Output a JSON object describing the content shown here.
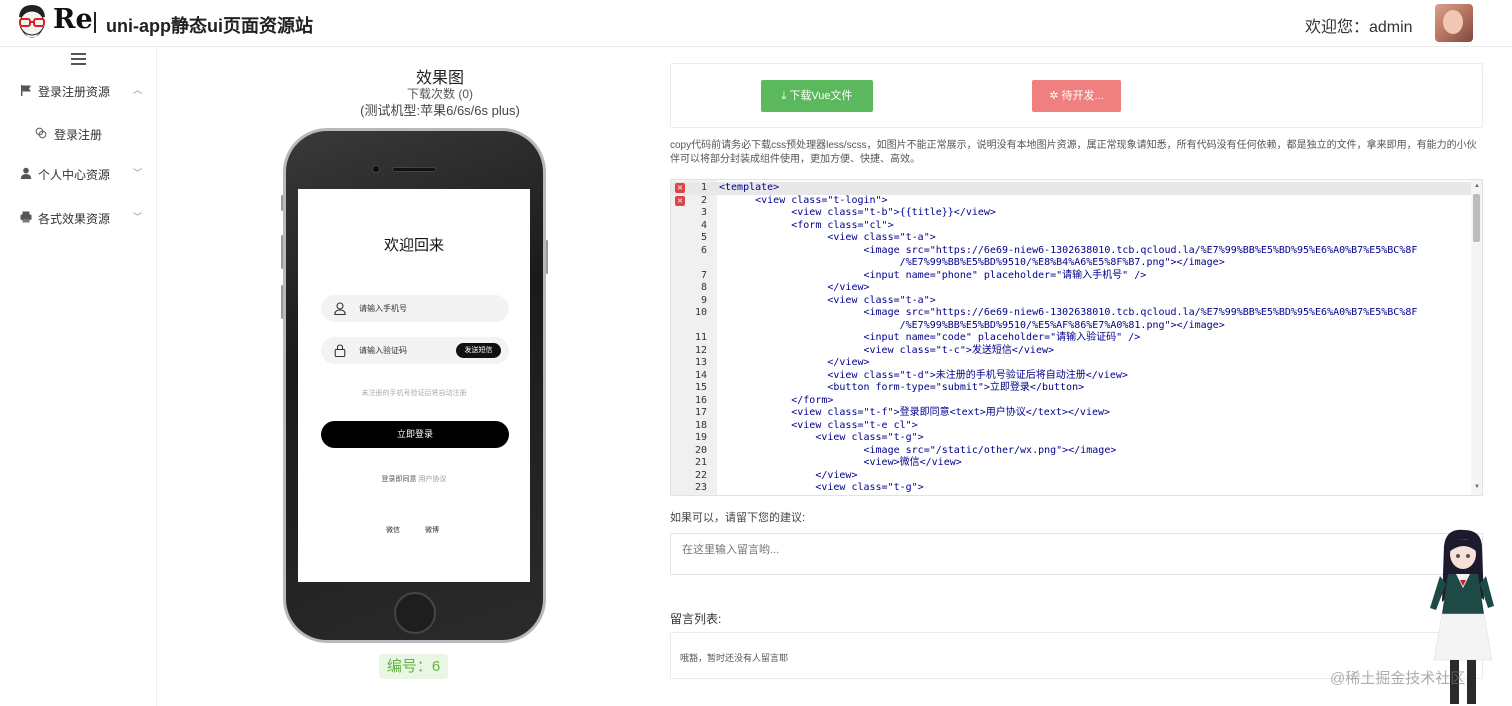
{
  "header": {
    "logo_text": "Re",
    "site_title": "uni-app静态ui页面资源站",
    "welcome": "欢迎您：admin"
  },
  "sidebar": {
    "items": [
      {
        "label": "登录注册资源",
        "icon": "flag-icon",
        "chevron": "^"
      },
      {
        "label": "登录注册",
        "icon": "link-icon"
      },
      {
        "label": "个人中心资源",
        "icon": "user-icon",
        "chevron": "v"
      },
      {
        "label": "各式效果资源",
        "icon": "printer-icon",
        "chevron": "v"
      }
    ]
  },
  "preview": {
    "title": "效果图",
    "downloads": "下载次数 (0)",
    "device": "(测试机型:苹果6/6s/6s plus)",
    "serial": "编号：6"
  },
  "phone_screen": {
    "title": "欢迎回来",
    "phone_placeholder": "请输入手机号",
    "code_placeholder": "请输入验证码",
    "send_code": "发送短信",
    "hint": "未注册的手机号验证后将自动注册",
    "login_button": "立即登录",
    "agree_prefix": "登录即同意",
    "agree_link": "用户协议",
    "social_1": "微信",
    "social_2": "微博"
  },
  "actions": {
    "download_label": "⤓ 下载Vue文件",
    "dev_label": "✲ 待开发..."
  },
  "notice": "copy代码前请务必下载css预处理器less/scss，如图片不能正常展示，说明没有本地图片资源，属正常现象请知悉，所有代码没有任何依赖，都是独立的文件，拿来即用，有能力的小伙伴可以将部分封装成组件使用，更加方便、快捷、高效。",
  "code_lines": [
    {
      "n": "1",
      "t": "<template>",
      "err": true
    },
    {
      "n": "2",
      "t": "      <view class=\"t-login\">",
      "err": true
    },
    {
      "n": "3",
      "t": "            <view class=\"t-b\">{{title}}</view>"
    },
    {
      "n": "4",
      "t": "            <form class=\"cl\">"
    },
    {
      "n": "5",
      "t": "                  <view class=\"t-a\">"
    },
    {
      "n": "6",
      "t": "                        <image src=\"https://6e69-niew6-1302638010.tcb.qcloud.la/%E7%99%BB%E5%BD%95%E6%A0%B7%E5%BC%8F"
    },
    {
      "n": "",
      "t": "                              /%E7%99%BB%E5%BD%9510/%E8%B4%A6%E5%8F%B7.png\"></image>"
    },
    {
      "n": "7",
      "t": "                        <input name=\"phone\" placeholder=\"请输入手机号\" />"
    },
    {
      "n": "8",
      "t": "                  </view>"
    },
    {
      "n": "9",
      "t": "                  <view class=\"t-a\">"
    },
    {
      "n": "10",
      "t": "                        <image src=\"https://6e69-niew6-1302638010.tcb.qcloud.la/%E7%99%BB%E5%BD%95%E6%A0%B7%E5%BC%8F"
    },
    {
      "n": "",
      "t": "                              /%E7%99%BB%E5%BD%9510/%E5%AF%86%E7%A0%81.png\"></image>"
    },
    {
      "n": "11",
      "t": "                        <input name=\"code\" placeholder=\"请输入验证码\" />"
    },
    {
      "n": "12",
      "t": "                        <view class=\"t-c\">发送短信</view>"
    },
    {
      "n": "13",
      "t": "                  </view>"
    },
    {
      "n": "14",
      "t": "                  <view class=\"t-d\">未注册的手机号验证后将自动注册</view>"
    },
    {
      "n": "15",
      "t": "                  <button form-type=\"submit\">立即登录</button>"
    },
    {
      "n": "16",
      "t": "            </form>"
    },
    {
      "n": "17",
      "t": "            <view class=\"t-f\">登录即同意<text>用户协议</text></view>"
    },
    {
      "n": "18",
      "t": "            <view class=\"t-e cl\">"
    },
    {
      "n": "19",
      "t": "                <view class=\"t-g\">"
    },
    {
      "n": "20",
      "t": "                        <image src=\"/static/other/wx.png\"></image>"
    },
    {
      "n": "21",
      "t": "                        <view>微信</view>"
    },
    {
      "n": "22",
      "t": "                </view>"
    },
    {
      "n": "23",
      "t": "                <view class=\"t-g\">"
    }
  ],
  "feedback": {
    "label": "如果可以，请留下您的建议:",
    "placeholder": "在这里输入留言哟..."
  },
  "messages": {
    "label": "留言列表:",
    "empty": "哦豁，暂时还没有人留言耶"
  },
  "watermark": "@稀土掘金技术社区"
}
